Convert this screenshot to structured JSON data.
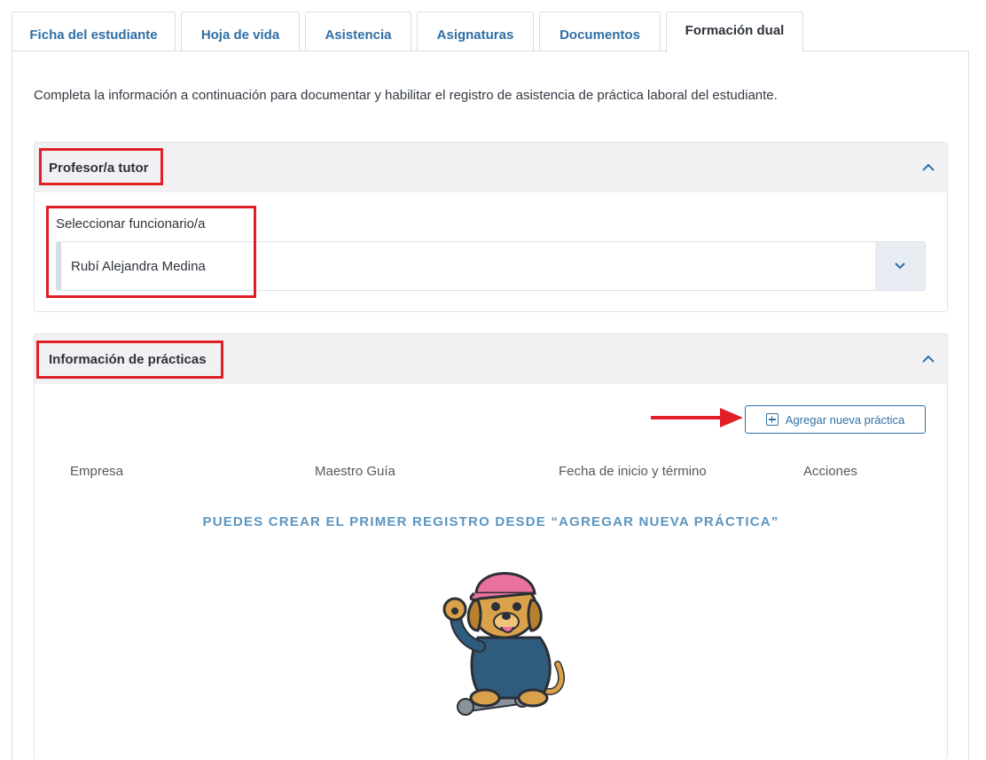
{
  "tabs": [
    {
      "label": "Ficha del estudiante",
      "active": false
    },
    {
      "label": "Hoja de vida",
      "active": false
    },
    {
      "label": "Asistencia",
      "active": false
    },
    {
      "label": "Asignaturas",
      "active": false
    },
    {
      "label": "Documentos",
      "active": false
    },
    {
      "label": "Formación dual",
      "active": true
    }
  ],
  "intro": "Completa la información a continuación para documentar y habilitar el registro de asistencia de práctica laboral del estudiante.",
  "tutor_panel": {
    "title": "Profesor/a tutor",
    "field_label": "Seleccionar funcionario/a",
    "selected_value": "Rubí Alejandra Medina"
  },
  "practicas_panel": {
    "title": "Información de prácticas",
    "add_button": "Agregar nueva práctica",
    "columns": [
      "Empresa",
      "Maestro Guía",
      "Fecha de inicio y término",
      "Acciones"
    ],
    "empty_message": "PUEDES CREAR EL PRIMER REGISTRO DESDE “AGREGAR NUEVA PRÁCTICA”"
  },
  "colors": {
    "accent": "#2f6fa5",
    "annotation_red": "#e01e26",
    "empty_text": "#5b95c0"
  }
}
